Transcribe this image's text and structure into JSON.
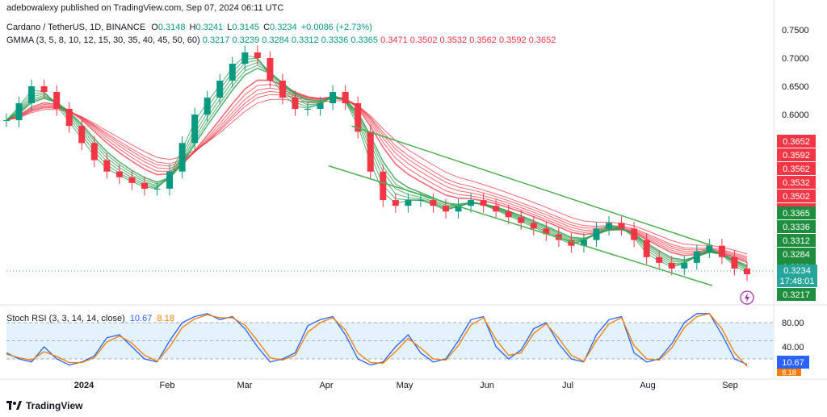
{
  "publisher": "adebowalexy published on TradingView.com, Sep 07, 2024 06:11 UTC",
  "legend": {
    "symbol": "Cardano / TetherUS, 1D, BINANCE",
    "o_label": "O",
    "o": "0.3148",
    "h_label": "H",
    "h": "0.3241",
    "l_label": "L",
    "l": "0.3145",
    "c_label": "C",
    "c": "0.3234",
    "change": "+0.0086 (+2.73%)",
    "gmma_label": "GMMA (3, 5, 8, 10, 12, 15, 30, 35, 40, 45, 50, 60)",
    "gmma_short": [
      "0.3217",
      "0.3239",
      "0.3284",
      "0.3312",
      "0.3336",
      "0.3365"
    ],
    "gmma_long": [
      "0.3471",
      "0.3502",
      "0.3532",
      "0.3562",
      "0.3592",
      "0.3652"
    ]
  },
  "rsi_legend": {
    "label": "Stoch RSI (3, 3, 14, 14, close)",
    "k": "10.67",
    "d": "8.18"
  },
  "footer": {
    "brand": "TradingView",
    "logo": "tradingview-logo-icon"
  },
  "colors": {
    "up": "#089981",
    "down": "#f23645",
    "short_ema": "#2e9e4f",
    "long_ema": "#f23645",
    "channel": "#4caf50",
    "k_line": "#2962ff",
    "d_line": "#f57c00",
    "rsi_band": "#e3f2fd",
    "price_tag": "#26a69a"
  },
  "chart_data": [
    {
      "type": "candlestick",
      "title": "Cardano / TetherUS, 1D, BINANCE",
      "y_ticks": [
        "0.7500",
        "0.7000",
        "0.6500",
        "0.6000"
      ],
      "y_tick_values": [
        0.75,
        0.7,
        0.65,
        0.6
      ],
      "x_ticks": [
        "2024",
        "Feb",
        "Mar",
        "Apr",
        "May",
        "Jun",
        "Jul",
        "Aug",
        "Sep"
      ],
      "current_price": "0.3234",
      "countdown": "17:48:01",
      "price_labels_long": [
        "0.3652",
        "0.3592",
        "0.3562",
        "0.3532",
        "0.3502",
        "0.3471"
      ],
      "price_labels_short": [
        "0.3365",
        "0.3336",
        "0.3312",
        "0.3284",
        "0.3239",
        "0.3217"
      ],
      "close_series": [
        0.59,
        0.62,
        0.65,
        0.64,
        0.61,
        0.58,
        0.55,
        0.52,
        0.5,
        0.49,
        0.48,
        0.47,
        0.47,
        0.5,
        0.55,
        0.6,
        0.63,
        0.66,
        0.69,
        0.71,
        0.7,
        0.66,
        0.63,
        0.61,
        0.61,
        0.62,
        0.64,
        0.62,
        0.57,
        0.5,
        0.45,
        0.44,
        0.45,
        0.45,
        0.44,
        0.43,
        0.44,
        0.45,
        0.44,
        0.43,
        0.42,
        0.41,
        0.4,
        0.39,
        0.38,
        0.37,
        0.38,
        0.4,
        0.41,
        0.4,
        0.38,
        0.35,
        0.34,
        0.33,
        0.34,
        0.36,
        0.37,
        0.35,
        0.33,
        0.32
      ],
      "channel_lines": [
        {
          "name": "upper",
          "points": [
            [
              0.45,
              0.58
            ],
            [
              0.92,
              0.37
            ]
          ]
        },
        {
          "name": "lower",
          "points": [
            [
              0.42,
              0.51
            ],
            [
              0.92,
              0.3
            ]
          ]
        }
      ]
    },
    {
      "type": "line",
      "title": "Stoch RSI (3, 3, 14, 14, close)",
      "y_ticks": [
        "80.00",
        "40.00"
      ],
      "levels": [
        80,
        50,
        20
      ],
      "series": [
        {
          "name": "K",
          "values": [
            30,
            20,
            15,
            40,
            20,
            10,
            15,
            25,
            55,
            60,
            40,
            20,
            15,
            50,
            80,
            90,
            95,
            85,
            90,
            70,
            40,
            15,
            20,
            30,
            75,
            85,
            90,
            60,
            20,
            10,
            15,
            40,
            60,
            30,
            15,
            20,
            50,
            85,
            90,
            40,
            20,
            35,
            70,
            80,
            45,
            20,
            15,
            60,
            85,
            90,
            30,
            15,
            20,
            45,
            80,
            95,
            95,
            60,
            20,
            11
          ]
        },
        {
          "name": "D",
          "values": [
            28,
            22,
            18,
            32,
            24,
            14,
            14,
            22,
            48,
            58,
            46,
            26,
            16,
            40,
            72,
            86,
            93,
            88,
            88,
            76,
            50,
            22,
            18,
            26,
            64,
            80,
            88,
            68,
            30,
            14,
            13,
            32,
            54,
            38,
            20,
            18,
            42,
            76,
            88,
            52,
            26,
            30,
            62,
            78,
            54,
            26,
            16,
            50,
            78,
            88,
            42,
            20,
            18,
            38,
            72,
            90,
            95,
            70,
            30,
            8
          ]
        }
      ],
      "current_k": "10.67",
      "current_d": "8.18"
    }
  ]
}
